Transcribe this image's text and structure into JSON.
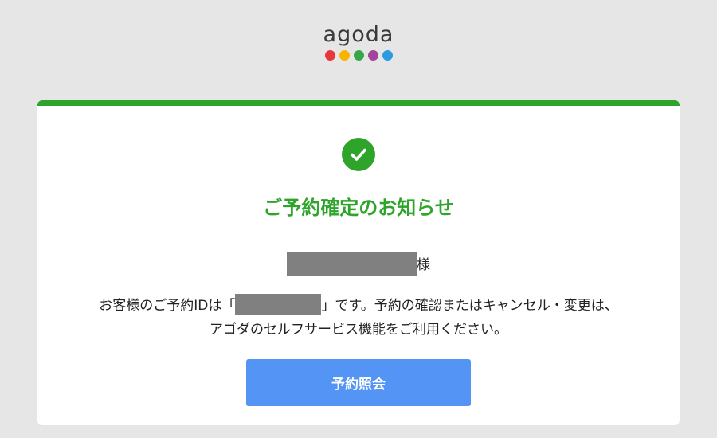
{
  "brand": {
    "logo_text": "agoda",
    "dots": [
      {
        "name": "red",
        "color": "#e8373c"
      },
      {
        "name": "yellow",
        "color": "#f7b500"
      },
      {
        "name": "green",
        "color": "#35a64a"
      },
      {
        "name": "purple",
        "color": "#a1449b"
      },
      {
        "name": "blue",
        "color": "#2a9be0"
      }
    ]
  },
  "colors": {
    "accent_green": "#2ea52a",
    "button_blue": "#5494f4"
  },
  "card": {
    "status_icon": "check-circle-icon",
    "title": "ご予約確定のお知らせ",
    "honorific": "様",
    "message_line1_prefix": "お客様のご予約IDは「",
    "message_line1_suffix": "」です。予約の確認またはキャンセル・変更は、",
    "message_line2": "アゴダのセルフサービス機能をご利用ください。",
    "button_label": "予約照会"
  }
}
